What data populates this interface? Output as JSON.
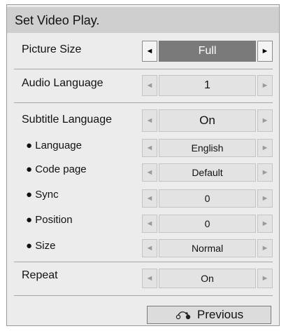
{
  "title": "Set Video Play.",
  "rows": [
    {
      "label": "Picture Size",
      "value": "Full"
    },
    {
      "label": "Audio Language",
      "value": "1"
    },
    {
      "label": "Subtitle Language",
      "value": "On"
    },
    {
      "label": "● Language",
      "value": "English"
    },
    {
      "label": "● Code page",
      "value": "Default"
    },
    {
      "label": "● Sync",
      "value": "0"
    },
    {
      "label": "● Position",
      "value": "0"
    },
    {
      "label": "● Size",
      "value": "Normal"
    },
    {
      "label": "Repeat",
      "value": "On"
    }
  ],
  "arrows": {
    "left": "◄",
    "right": "►",
    "left_icon": "left-arrow-icon",
    "right_icon": "right-arrow-icon"
  },
  "previous_button": {
    "label": "Previous",
    "icon": "return-icon"
  },
  "colors": {
    "panel_bg": "#ececec",
    "title_bg": "#cfcfcf",
    "active_value_bg": "#7a7a7a",
    "button_bg": "#dcdcdc"
  }
}
